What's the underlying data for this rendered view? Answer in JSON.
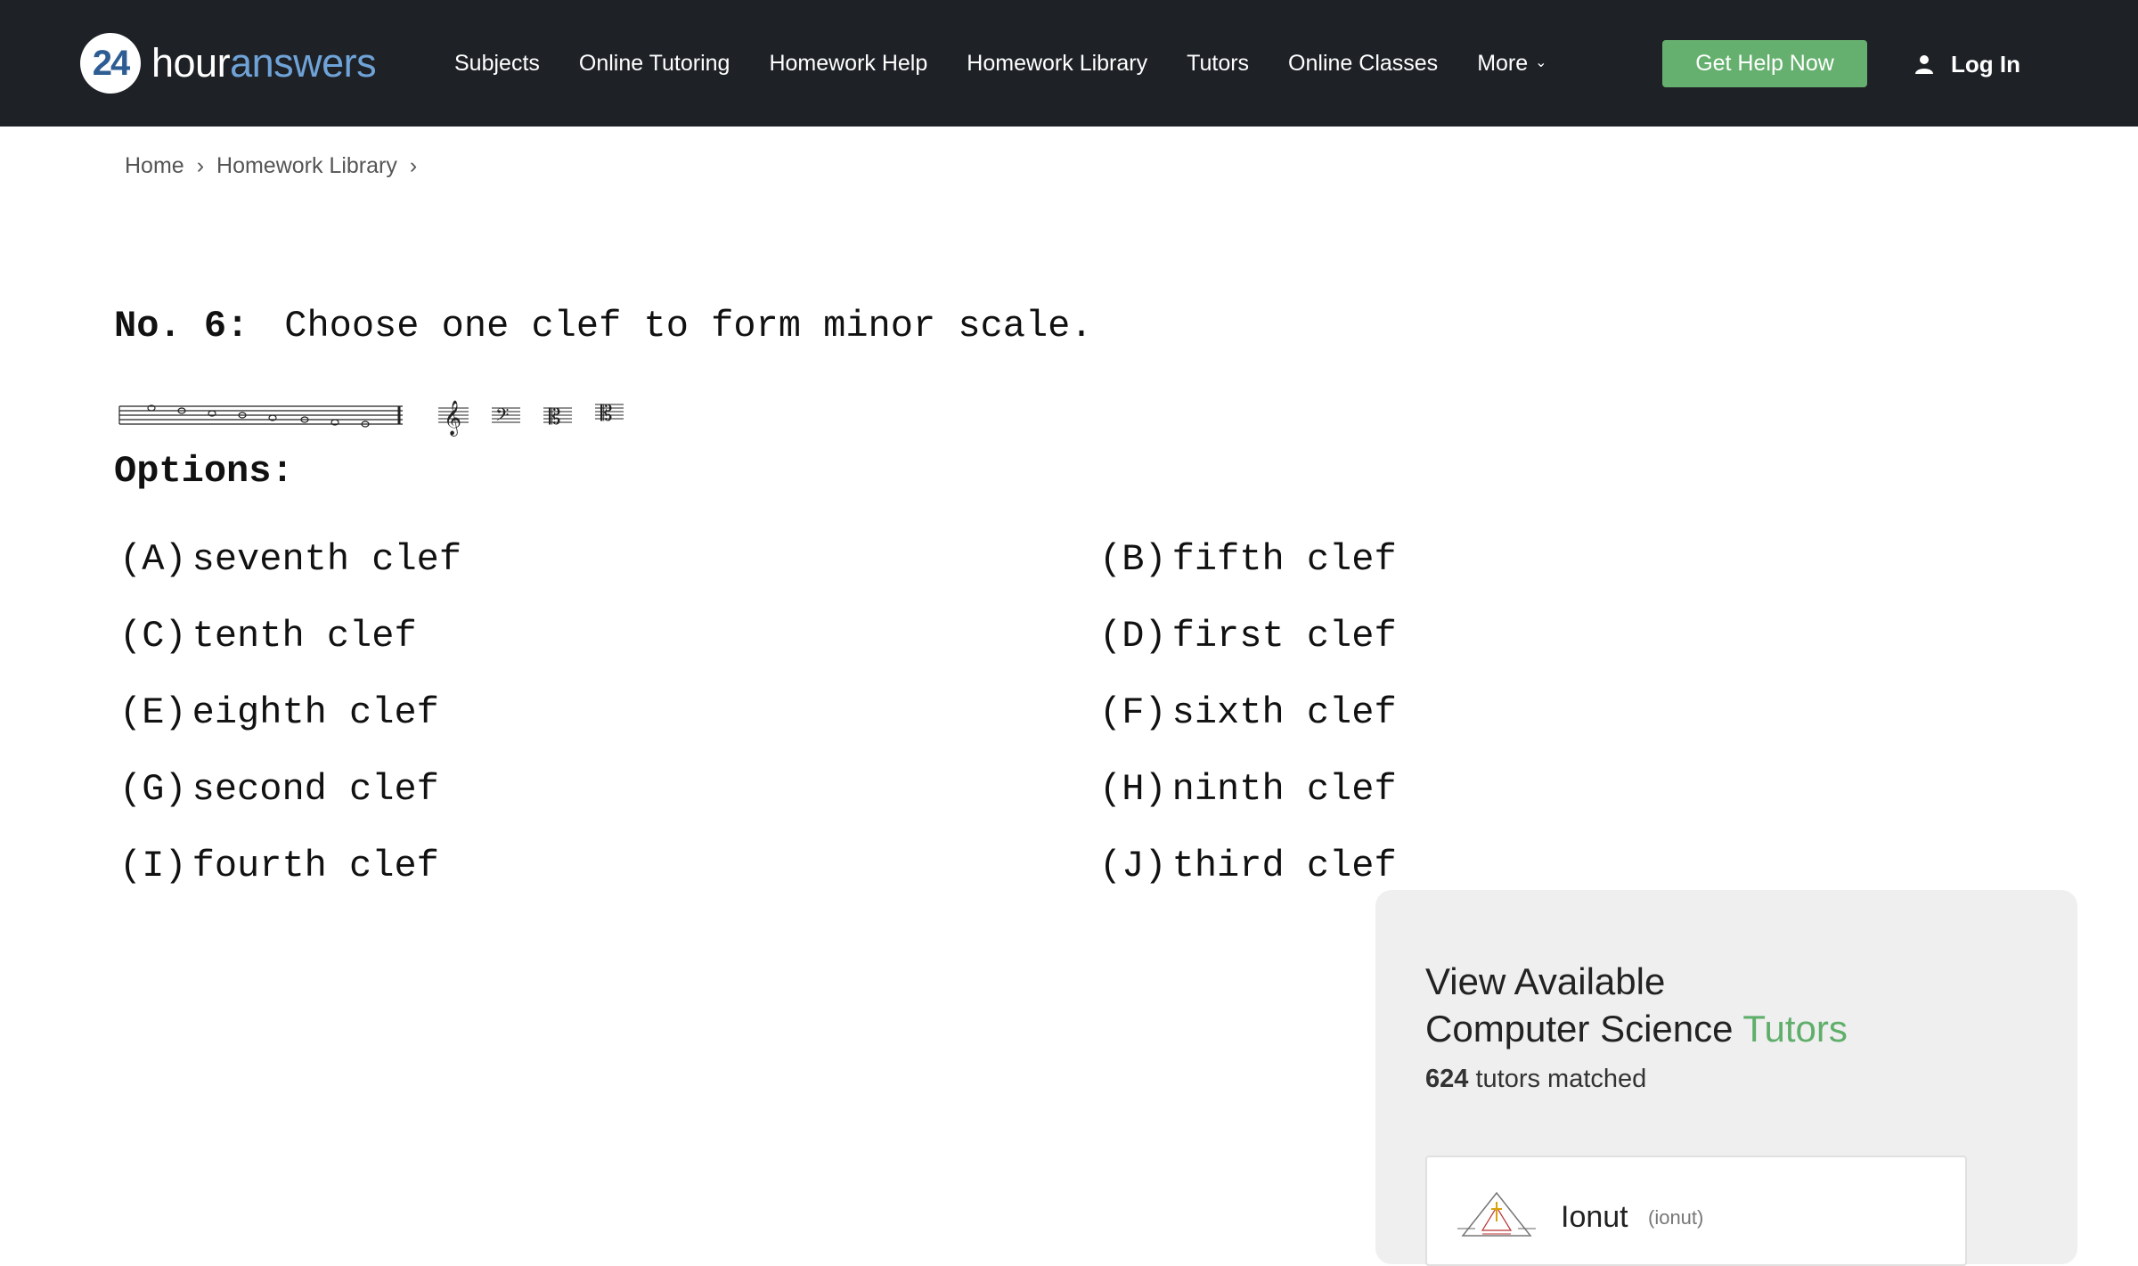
{
  "header": {
    "logo_number": "24",
    "logo_word_1": "hour",
    "logo_word_2": "answers",
    "nav": [
      "Subjects",
      "Online Tutoring",
      "Homework Help",
      "Homework Library",
      "Tutors",
      "Online Classes"
    ],
    "more_label": "More",
    "cta_label": "Get Help Now",
    "login_label": "Log In",
    "colors": {
      "bar": "#1e2126",
      "cta": "#66b06f",
      "accent": "#6fa3d8"
    }
  },
  "breadcrumb": {
    "items": [
      "Home",
      "Homework Library"
    ],
    "separator": "›"
  },
  "question": {
    "number_label": "No. 6:",
    "text": "Choose one clef to form minor scale.",
    "options_title": "Options:",
    "options": [
      {
        "letter": "(A)",
        "text": "seventh clef"
      },
      {
        "letter": "(B)",
        "text": "fifth clef"
      },
      {
        "letter": "(C)",
        "text": "tenth clef"
      },
      {
        "letter": "(D)",
        "text": "first clef"
      },
      {
        "letter": "(E)",
        "text": "eighth clef"
      },
      {
        "letter": "(F)",
        "text": "sixth clef"
      },
      {
        "letter": "(G)",
        "text": "second clef"
      },
      {
        "letter": "(H)",
        "text": "ninth clef"
      },
      {
        "letter": "(I)",
        "text": "fourth clef"
      },
      {
        "letter": "(J)",
        "text": "third clef"
      }
    ],
    "clef_icons": [
      "treble-clef-icon",
      "bass-clef-icon",
      "alto-clef-icon",
      "tenor-clef-icon"
    ]
  },
  "tutors_panel": {
    "title_line1": "View Available",
    "title_subject": "Computer Science",
    "title_accent": "Tutors",
    "count": "624",
    "count_suffix": "tutors matched",
    "tutor": {
      "name": "Ionut",
      "handle": "(ionut)"
    }
  }
}
